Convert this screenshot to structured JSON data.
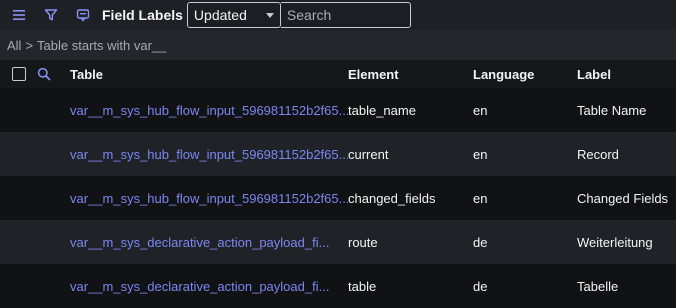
{
  "toolbar": {
    "menu_icon": "hamburger-menu-icon",
    "filter_icon": "funnel-filter-icon",
    "context_icon": "context-menu-icon",
    "title": "Field Labels",
    "select_value": "Updated",
    "search_placeholder": "Search"
  },
  "breadcrumb": {
    "root": "All",
    "separator": ">",
    "condition": "Table starts with var__"
  },
  "columns": [
    "Table",
    "Element",
    "Language",
    "Label"
  ],
  "rows": [
    {
      "table": "var__m_sys_hub_flow_input_596981152b2f65...",
      "element": "table_name",
      "language": "en",
      "label": "Table Name"
    },
    {
      "table": "var__m_sys_hub_flow_input_596981152b2f65...",
      "element": "current",
      "language": "en",
      "label": "Record"
    },
    {
      "table": "var__m_sys_hub_flow_input_596981152b2f65...",
      "element": "changed_fields",
      "language": "en",
      "label": "Changed Fields"
    },
    {
      "table": "var__m_sys_declarative_action_payload_fi...",
      "element": "route",
      "language": "de",
      "label": "Weiterleitung"
    },
    {
      "table": "var__m_sys_declarative_action_payload_fi...",
      "element": "table",
      "language": "de",
      "label": "Tabelle"
    }
  ],
  "colors": {
    "link": "#7c86f2",
    "accent_icon": "#8a93f5"
  }
}
